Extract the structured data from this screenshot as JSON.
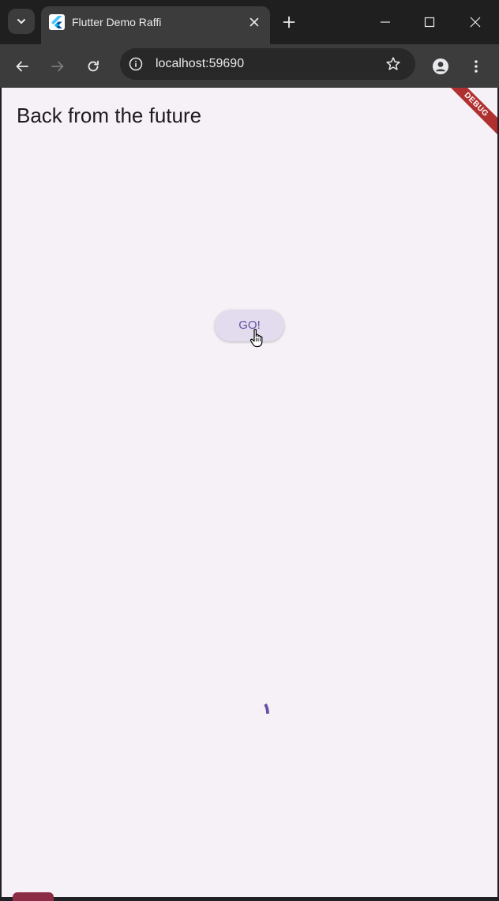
{
  "browser": {
    "tab": {
      "title": "Flutter Demo Raffi",
      "favicon": "flutter-icon"
    },
    "toolbar": {
      "url": "localhost:59690",
      "back_icon": "back-arrow-icon",
      "forward_icon": "forward-arrow-icon",
      "reload_icon": "reload-icon",
      "info_icon": "info-icon",
      "star_icon": "star-icon",
      "profile_icon": "profile-icon",
      "menu_icon": "kebab-menu-icon"
    }
  },
  "app": {
    "appbar_title": "Back from the future",
    "debug_banner": "DEBUG",
    "go_button_label": "GO!",
    "colors": {
      "background": "#f6f1f7",
      "primary": "#6750a4",
      "button_fill": "#e2dcee",
      "debug_banner": "#b03030"
    }
  }
}
